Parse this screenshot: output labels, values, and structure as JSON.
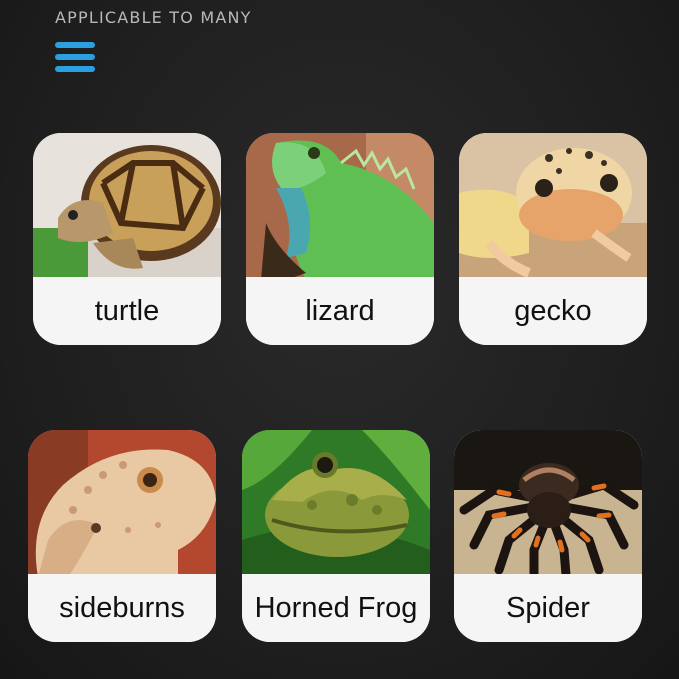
{
  "header": {
    "title": "APPLICABLE TO MANY",
    "menu_icon": "hamburger-menu-icon"
  },
  "cards": [
    {
      "label": "turtle",
      "image": "turtle-photo"
    },
    {
      "label": "lizard",
      "image": "lizard-photo"
    },
    {
      "label": "gecko",
      "image": "gecko-photo"
    },
    {
      "label": "sideburns",
      "image": "bearded-dragon-photo"
    },
    {
      "label": "Horned Frog",
      "image": "horned-frog-photo"
    },
    {
      "label": "Spider",
      "image": "tarantula-photo"
    }
  ],
  "colors": {
    "accent": "#2aa0e0",
    "background": "#1f1f1f",
    "card": "#f5f5f5"
  }
}
